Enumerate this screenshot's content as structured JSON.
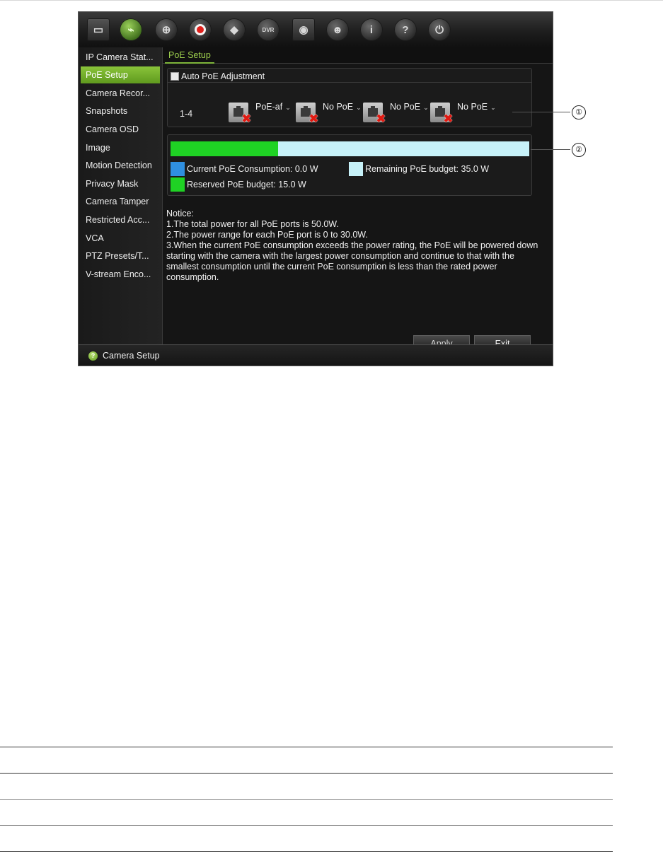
{
  "toolbar": {
    "icons": [
      "monitor-icon",
      "camera-icon",
      "network-icon",
      "record-icon",
      "alarm-icon",
      "device-icon",
      "storage-icon",
      "user-icon",
      "info-icon",
      "help-icon",
      "power-icon"
    ],
    "active_icon": "camera-icon",
    "device_icon_text": "DVR"
  },
  "sidebar": {
    "items": [
      {
        "label": "IP Camera Stat..."
      },
      {
        "label": "PoE Setup",
        "selected": true
      },
      {
        "label": "Camera Recor..."
      },
      {
        "label": "Snapshots"
      },
      {
        "label": "Camera OSD"
      },
      {
        "label": "Image"
      },
      {
        "label": "Motion Detection"
      },
      {
        "label": "Privacy Mask"
      },
      {
        "label": "Camera Tamper"
      },
      {
        "label": "Restricted Acc..."
      },
      {
        "label": "VCA"
      },
      {
        "label": "PTZ Presets/T..."
      },
      {
        "label": "V-stream Enco..."
      }
    ]
  },
  "main": {
    "tab_label": "PoE Setup",
    "auto_poe_label": "Auto PoE Adjustment",
    "auto_poe_checked": false,
    "port_range": "1-4",
    "ports": [
      {
        "value": "PoE-af",
        "status": "disconnected"
      },
      {
        "value": "No PoE",
        "status": "disconnected"
      },
      {
        "value": "No PoE",
        "status": "disconnected"
      },
      {
        "value": "No PoE",
        "status": "disconnected"
      }
    ],
    "budget": {
      "reserved_fraction": 0.3,
      "colors": {
        "consumption": "#2f8fe0",
        "remaining": "#c6f1f8",
        "reserved": "#1fd224"
      },
      "current_label": "Current PoE Consumption: 0.0 W",
      "remaining_label": "Remaining PoE budget: 35.0 W",
      "reserved_label": "Reserved PoE budget: 15.0 W"
    },
    "notice": [
      "Notice:",
      "1.The total power for all PoE ports is 50.0W.",
      "2.The power range for each PoE port is 0 to 30.0W.",
      "3.When the current PoE consumption exceeds the power rating, the PoE will be powered down starting with the camera with the largest power consumption and continue to that with the smallest consumption until the current PoE consumption is less than the rated power consumption."
    ],
    "apply_label": "Apply",
    "exit_label": "Exit"
  },
  "statusbar": {
    "text": "Camera Setup"
  },
  "callouts": [
    "①",
    "②"
  ],
  "theme": {
    "accent": "#7eb53a",
    "background": "#151515"
  }
}
